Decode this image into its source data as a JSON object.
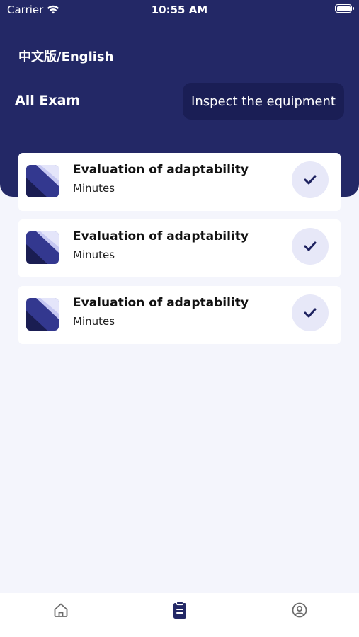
{
  "status_bar": {
    "carrier": "Carrier",
    "time": "10:55 AM"
  },
  "header": {
    "language_toggle": "中文版/English",
    "section_title": "All Exam",
    "inspect_button": "Inspect the equipment"
  },
  "exams": [
    {
      "title": "Evaluation of adaptability",
      "subtitle": "Minutes",
      "status_icon": "check-icon"
    },
    {
      "title": "Evaluation of adaptability",
      "subtitle": "Minutes",
      "status_icon": "check-icon"
    },
    {
      "title": "Evaluation of adaptability",
      "subtitle": "Minutes",
      "status_icon": "check-icon"
    }
  ],
  "tabbar": {
    "tabs": [
      {
        "icon": "home-icon",
        "active": false
      },
      {
        "icon": "clipboard-icon",
        "active": true
      },
      {
        "icon": "profile-icon",
        "active": false
      }
    ]
  },
  "colors": {
    "header_bg": "#232866",
    "button_bg": "#1A1E55",
    "page_bg": "#F4F5FC",
    "check_bg": "#E7E8F8",
    "accent": "#232866",
    "inactive_icon": "#6b6b6b"
  }
}
